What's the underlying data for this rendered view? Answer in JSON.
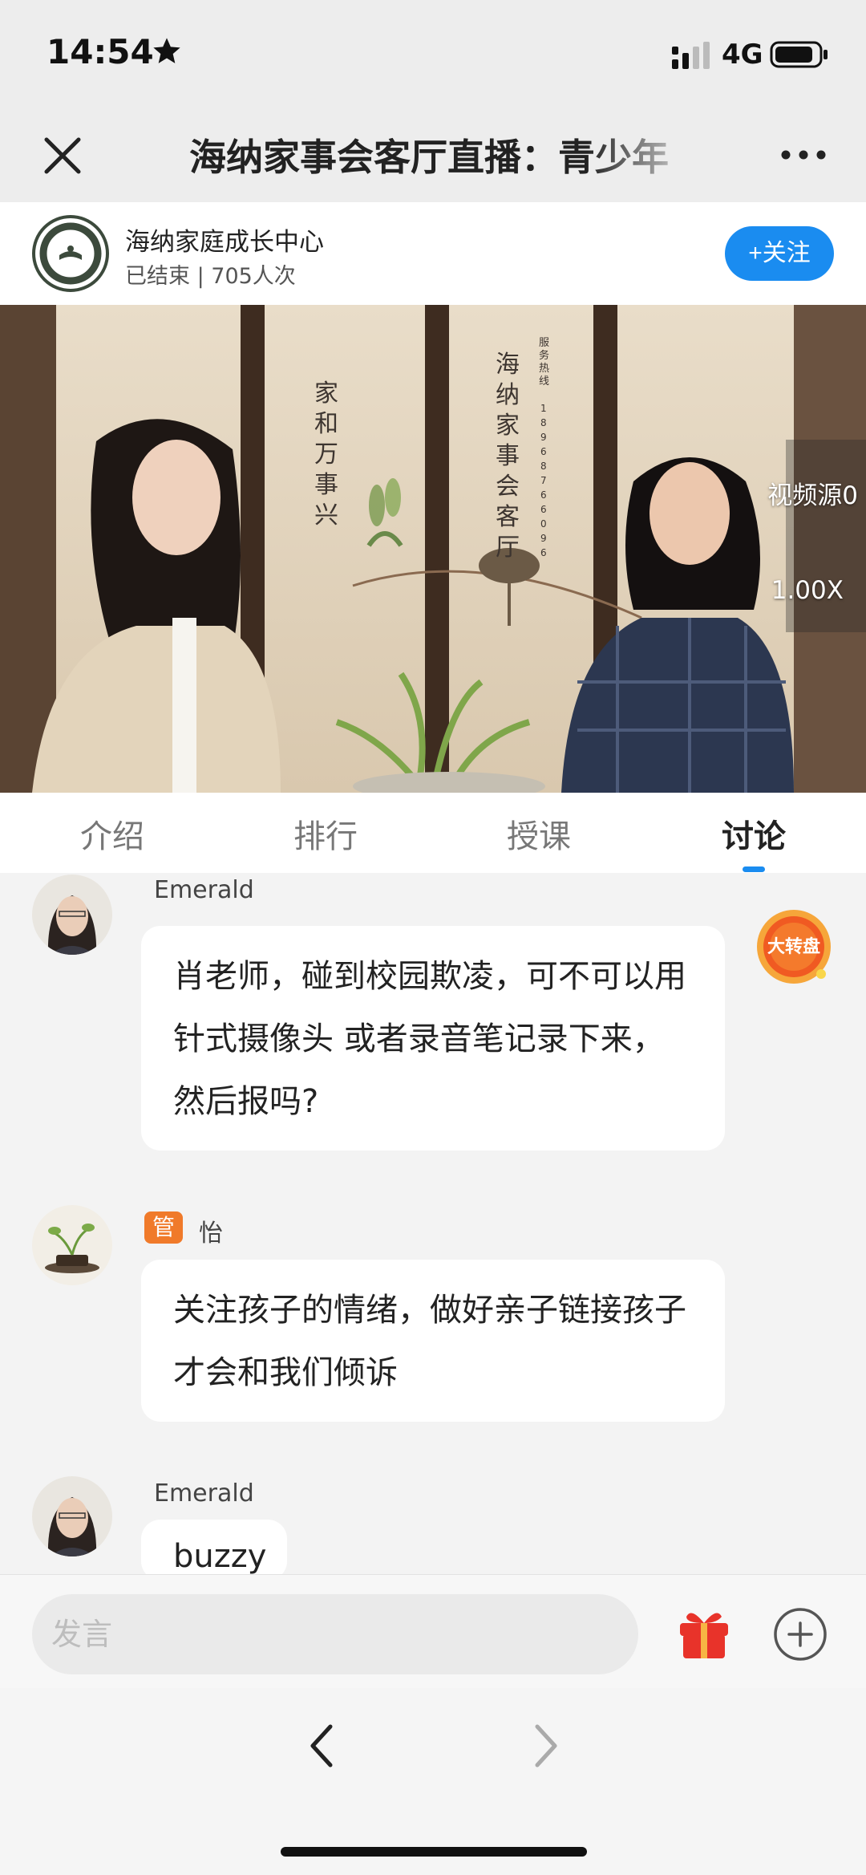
{
  "status_bar": {
    "time": "14:54",
    "network": "4G"
  },
  "title_bar": {
    "title": "海纳家事会客厅直播：青少年"
  },
  "host": {
    "name": "海纳家庭成长中心",
    "meta": "已结束 | 705人次",
    "follow_label": "+关注"
  },
  "video": {
    "source_label": "视频源0",
    "speed_label": "1.00X",
    "screen_text_left": "家和万事兴",
    "screen_text_middle": "海纳家事会客厅",
    "screen_text_hotline_label": "服务热线",
    "screen_text_hotline": "18968766096"
  },
  "tabs": [
    {
      "label": "介绍"
    },
    {
      "label": "排行"
    },
    {
      "label": "授课"
    },
    {
      "label": "讨论"
    }
  ],
  "active_tab": 3,
  "messages": [
    {
      "author": "Emerald",
      "text": "肖老师，碰到校园欺凌，可不可以用针式摄像头 或者录音笔记录下来，然后报吗?"
    },
    {
      "author": "怡",
      "badge": "管",
      "text": "关注孩子的情绪，做好亲子链接孩子才会和我们倾诉"
    },
    {
      "author": "Emerald",
      "text": "buzzy"
    }
  ],
  "lucky_wheel_label": "大转盘",
  "input": {
    "placeholder": "发言"
  },
  "colors": {
    "accent": "#1a8cf0",
    "badge": "#f07a2a",
    "gift": "#e8332a"
  }
}
